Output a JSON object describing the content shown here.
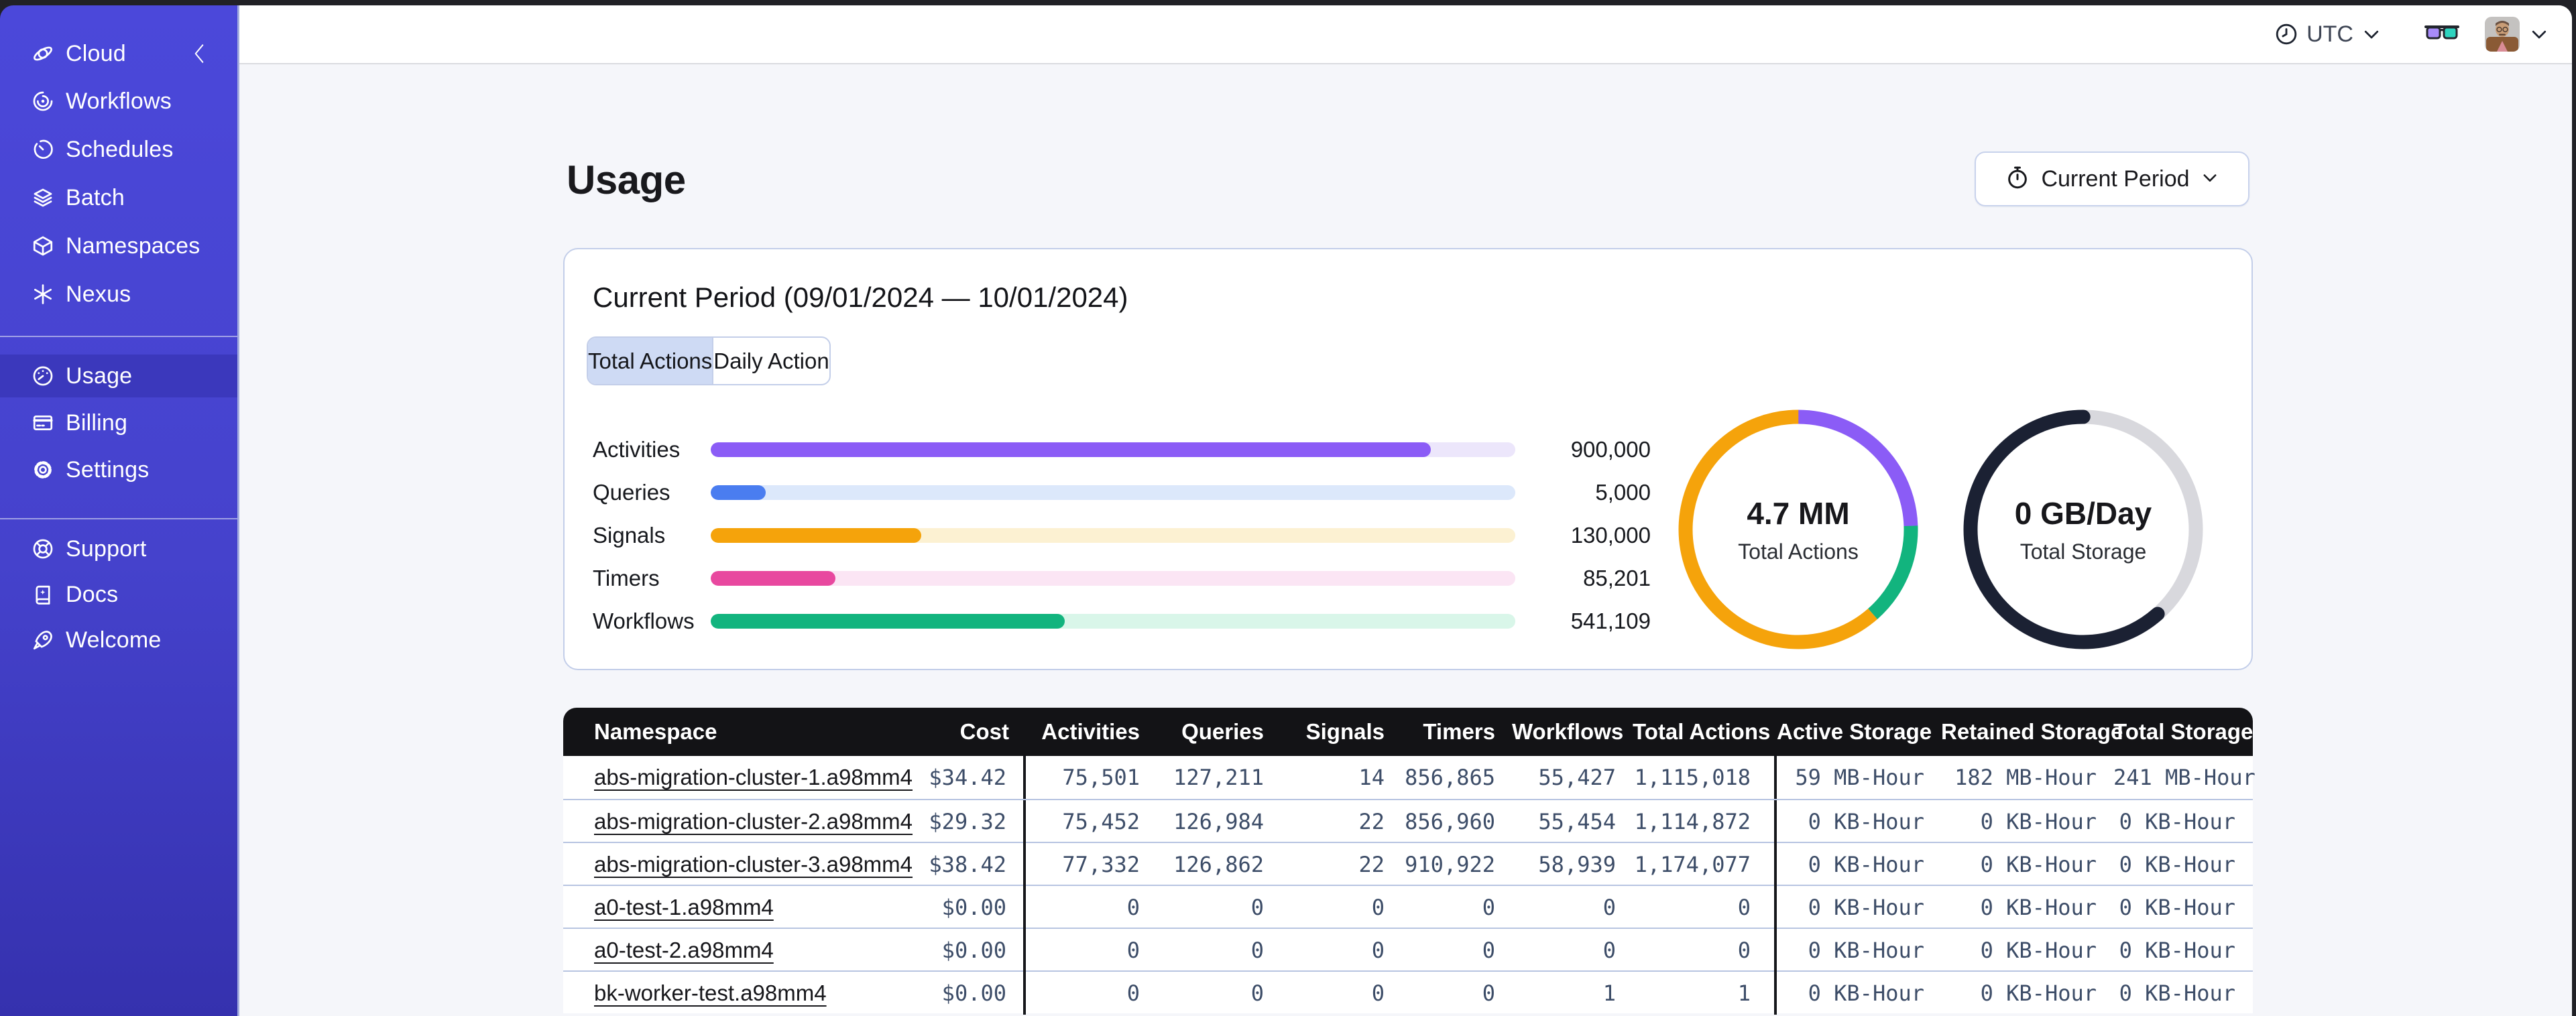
{
  "topbar": {
    "timezone": "UTC"
  },
  "sidebar": {
    "header": {
      "label": "Cloud"
    },
    "group1": [
      {
        "label": "Workflows"
      },
      {
        "label": "Schedules"
      },
      {
        "label": "Batch"
      },
      {
        "label": "Namespaces"
      },
      {
        "label": "Nexus"
      }
    ],
    "group2": [
      {
        "label": "Usage",
        "active": true
      },
      {
        "label": "Billing"
      },
      {
        "label": "Settings"
      }
    ],
    "group3": [
      {
        "label": "Support"
      },
      {
        "label": "Docs"
      },
      {
        "label": "Welcome"
      }
    ]
  },
  "page": {
    "title": "Usage"
  },
  "period_selector": {
    "label": "Current Period"
  },
  "usage_card": {
    "title": "Current Period (09/01/2024 — 10/01/2024)",
    "tabs": [
      {
        "label": "Total Actions",
        "selected": true
      },
      {
        "label": "Daily Actions",
        "selected": false
      }
    ]
  },
  "chart_data": [
    {
      "type": "bar",
      "orientation": "horizontal",
      "categories": [
        "Activities",
        "Queries",
        "Signals",
        "Timers",
        "Workflows"
      ],
      "values": [
        900000,
        5000,
        130000,
        85201,
        541109
      ],
      "value_labels": [
        "900,000",
        "5,000",
        "130,000",
        "85,201",
        "541,109"
      ],
      "bar_colors": [
        "#8B5CF6",
        "#4A7DF0",
        "#F5A30B",
        "#E8489F",
        "#12B47E"
      ],
      "track_colors": [
        "#ECE6FB",
        "#DCE8FB",
        "#FCF1D2",
        "#FBE5F4",
        "#D9F6E9"
      ],
      "bar_fractions": [
        0.895,
        0.068,
        0.262,
        0.155,
        0.44
      ]
    },
    {
      "type": "donut",
      "center_label": "4.7 MM",
      "center_sublabel": "Total Actions",
      "segments": [
        {
          "name": "purple",
          "color": "#8B5CF6",
          "fraction": 0.245
        },
        {
          "name": "green",
          "color": "#12B47E",
          "fraction": 0.14
        },
        {
          "name": "orange",
          "color": "#F5A30B",
          "fraction": 0.615
        }
      ]
    },
    {
      "type": "donut",
      "center_label": "0 GB/Day",
      "center_sublabel": "Total Storage",
      "segments": [
        {
          "name": "gray",
          "color": "#D8D8DD",
          "fraction": 0.385
        },
        {
          "name": "dark",
          "color": "#1B2133",
          "fraction": 0.615,
          "linecap": "round"
        }
      ]
    }
  ],
  "table": {
    "headers": [
      "Namespace",
      "Cost",
      "Activities",
      "Queries",
      "Signals",
      "Timers",
      "Workflows",
      "Total Actions",
      "Active Storage",
      "Retained Storage",
      "Total Storage"
    ],
    "rows": [
      {
        "namespace": "abs-migration-cluster-1.a98mm4",
        "cost": "$34.42",
        "activities": "75,501",
        "queries": "127,211",
        "signals": "14",
        "timers": "856,865",
        "workflows": "55,427",
        "total_actions": "1,115,018",
        "active_storage": "59 MB-Hour",
        "retained_storage": "182 MB-Hour",
        "total_storage": "241 MB-Hour"
      },
      {
        "namespace": "abs-migration-cluster-2.a98mm4",
        "cost": "$29.32",
        "activities": "75,452",
        "queries": "126,984",
        "signals": "22",
        "timers": "856,960",
        "workflows": "55,454",
        "total_actions": "1,114,872",
        "active_storage": "0 KB-Hour",
        "retained_storage": "0 KB-Hour",
        "total_storage": "0 KB-Hour"
      },
      {
        "namespace": "abs-migration-cluster-3.a98mm4",
        "cost": "$38.42",
        "activities": "77,332",
        "queries": "126,862",
        "signals": "22",
        "timers": "910,922",
        "workflows": "58,939",
        "total_actions": "1,174,077",
        "active_storage": "0 KB-Hour",
        "retained_storage": "0 KB-Hour",
        "total_storage": "0 KB-Hour"
      },
      {
        "namespace": "a0-test-1.a98mm4",
        "cost": "$0.00",
        "activities": "0",
        "queries": "0",
        "signals": "0",
        "timers": "0",
        "workflows": "0",
        "total_actions": "0",
        "active_storage": "0 KB-Hour",
        "retained_storage": "0 KB-Hour",
        "total_storage": "0 KB-Hour"
      },
      {
        "namespace": "a0-test-2.a98mm4",
        "cost": "$0.00",
        "activities": "0",
        "queries": "0",
        "signals": "0",
        "timers": "0",
        "workflows": "0",
        "total_actions": "0",
        "active_storage": "0 KB-Hour",
        "retained_storage": "0 KB-Hour",
        "total_storage": "0 KB-Hour"
      },
      {
        "namespace": "bk-worker-test.a98mm4",
        "cost": "$0.00",
        "activities": "0",
        "queries": "0",
        "signals": "0",
        "timers": "0",
        "workflows": "1",
        "total_actions": "1",
        "active_storage": "0 KB-Hour",
        "retained_storage": "0 KB-Hour",
        "total_storage": "0 KB-Hour"
      }
    ]
  },
  "colors": {
    "sidebar_top": "#4B48DA",
    "sidebar_bottom": "#3531AE",
    "sidebar_active": "#3B38BC",
    "card_border": "#C3CEE9",
    "table_header_bg": "#131316",
    "row_divider": "#B7C4E1",
    "numeric_text": "#3D4D68"
  }
}
